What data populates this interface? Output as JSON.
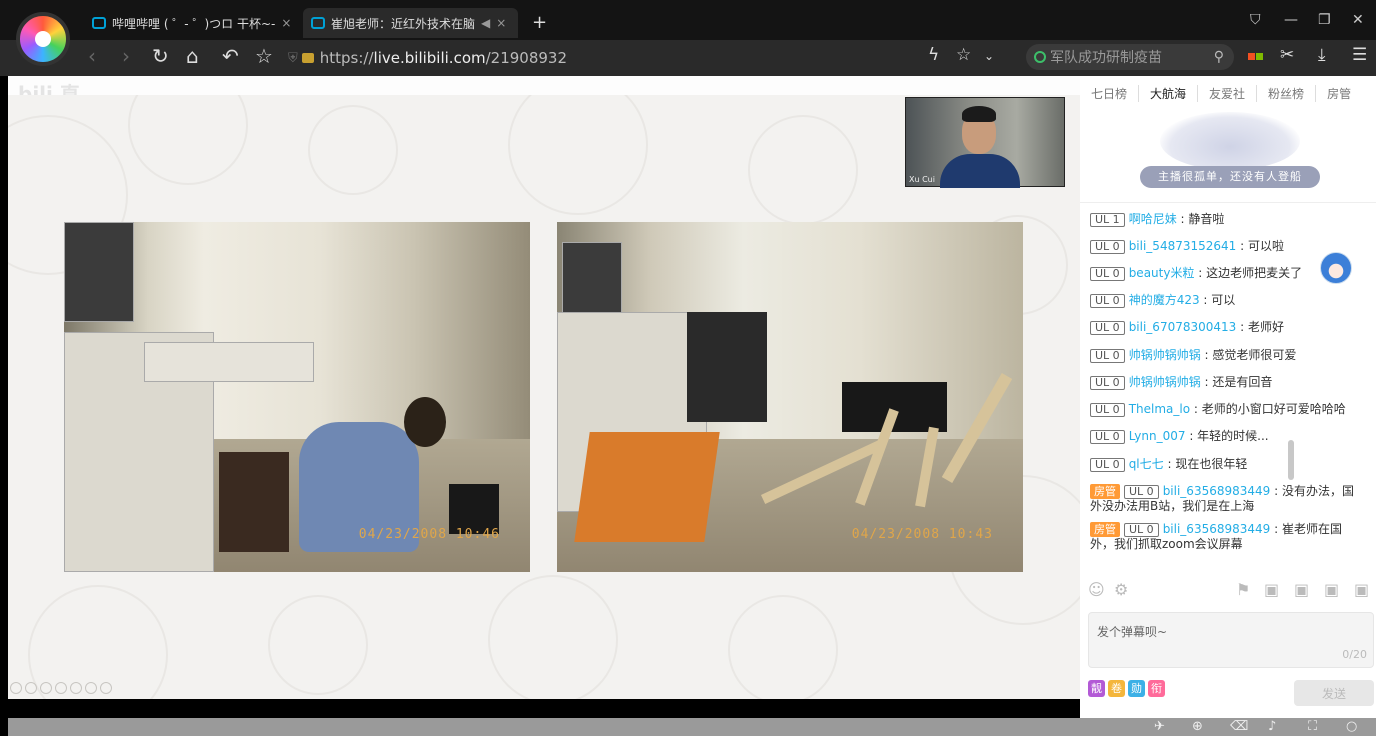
{
  "browser": {
    "tabs": [
      {
        "title": "哔哩哔哩 ( ゜- ゜)つロ 干杯~-",
        "close": "×"
      },
      {
        "title": "崔旭老师：近红外技术在脑",
        "close": "×",
        "audio": "◀"
      }
    ],
    "new_tab": "+",
    "url_prefix": "https://",
    "url_host": "live.bilibili.com",
    "url_path": "/21908932",
    "search_placeholder": "军队成功研制疫苗",
    "icons": [
      "back-icon",
      "forward-icon",
      "reload-icon",
      "home-icon",
      "undo-icon",
      "star-icon",
      "search-icon",
      "apps-icon",
      "cut-icon",
      "download-icon",
      "menu-icon"
    ]
  },
  "video": {
    "cam_name": "Xu Cui",
    "photo1_timestamp": "04/23/2008 10:46",
    "photo2_timestamp": "04/23/2008 10:43",
    "site_partial": "bili 直"
  },
  "panel": {
    "tabs": [
      "七日榜",
      "大航海",
      "友爱社",
      "粉丝榜",
      "房管"
    ],
    "active_tab": "大航海",
    "fleet_banner": "主播很孤单，还没有人登船",
    "messages": [
      {
        "level": "UL 1",
        "user": "啊哈尼妹",
        "text": "静音啦"
      },
      {
        "level": "UL 0",
        "user": "bili_54873152641",
        "text": "可以啦"
      },
      {
        "level": "UL 0",
        "user": "beauty米粒",
        "text": "这边老师把麦关了"
      },
      {
        "level": "UL 0",
        "user": "神的魔方423",
        "text": "可以"
      },
      {
        "level": "UL 0",
        "user": "bili_67078300413",
        "text": "老师好"
      },
      {
        "level": "UL 0",
        "user": "帅锅帅锅帅锅",
        "text": "感觉老师很可爱"
      },
      {
        "level": "UL 0",
        "user": "帅锅帅锅帅锅",
        "text": "还是有回音"
      },
      {
        "level": "UL 0",
        "user": "Thelma_lo",
        "text": "老师的小窗口好可爱哈哈哈"
      },
      {
        "level": "UL 0",
        "user": "Lynn_007",
        "text": "年轻的时候..."
      },
      {
        "level": "UL 0",
        "user": "ql七七",
        "text": "现在也很年轻"
      },
      {
        "admin": "房管",
        "level": "UL 0",
        "user": "bili_63568983449",
        "text": "没有办法，国外没办法用B站，我们是在上海"
      },
      {
        "admin": "房管",
        "level": "UL 0",
        "user": "bili_63568983449",
        "text": "崔老师在国外，我们抓取zoom会议屏幕"
      }
    ],
    "input_placeholder": "发个弹幕呗~",
    "char_count": "0/20",
    "send_label": "发送",
    "badges": [
      {
        "label": "靓",
        "color": "#b35ad6"
      },
      {
        "label": "卷",
        "color": "#f4b63c"
      },
      {
        "label": "勋",
        "color": "#3cb0e6"
      },
      {
        "label": "衔",
        "color": "#ff6b9a"
      }
    ]
  },
  "colors": {
    "accent": "#23ade5",
    "admin": "#ff9a36",
    "chrome_bg": "#2a2a2a"
  }
}
